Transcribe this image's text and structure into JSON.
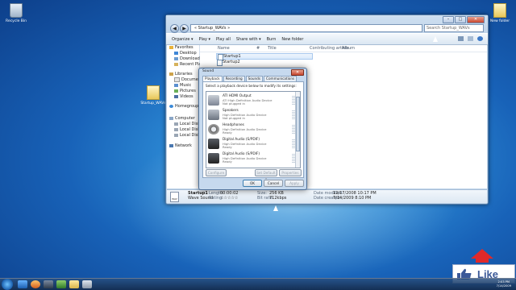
{
  "desktop": {
    "icons": {
      "recycle_bin": "Recycle Bin",
      "new_folder": "New folder",
      "startup_folder": "Startup_WAVs"
    }
  },
  "explorer": {
    "address": "« Startup_WAVs »",
    "search_placeholder": "Search Startup_WAVs",
    "toolbar": {
      "organize": "Organize ▾",
      "play": "Play ▾",
      "play_all": "Play all",
      "share_with": "Share with ▾",
      "burn": "Burn",
      "new_folder": "New folder"
    },
    "nav": {
      "favorites": "Favorites",
      "desktop": "Desktop",
      "downloads": "Downloads",
      "recent_places": "Recent Places",
      "libraries": "Libraries",
      "documents": "Documents",
      "music": "Music",
      "pictures": "Pictures",
      "videos": "Videos",
      "homegroup": "Homegroup",
      "computer": "Computer",
      "local_disk_1": "Local Disk",
      "local_disk_2": "Local Disk",
      "local_disk_3": "Local Disk",
      "network": "Network"
    },
    "columns": {
      "name": "Name",
      "num": "#",
      "title": "Title",
      "artists": "Contributing artists",
      "album": "Album"
    },
    "files": [
      "Startup1",
      "Startup2"
    ],
    "details": {
      "name": "Startup1",
      "type": "WAV",
      "length_label": "Length:",
      "length": "00:00:02",
      "rating_label": "Rating:",
      "rating_stars": "☆☆☆☆☆",
      "subtitle": "Wave Sound",
      "size_label": "Size:",
      "size": "256 KB",
      "bitrate_label": "Bit rate:",
      "bitrate": "712kbps",
      "modified_label": "Date modified:",
      "modified": "12/17/2008 10:17 PM",
      "created_label": "Date created:",
      "created": "7/14/2009 8:10 PM"
    }
  },
  "sound_dialog": {
    "title": "Sound",
    "tabs": [
      "Playback",
      "Recording",
      "Sounds",
      "Communications"
    ],
    "instruction": "Select a playback device below to modify its settings:",
    "devices": [
      {
        "name": "ATI HDMI Output",
        "line1": "ATI High Definition Audio Device",
        "line2": "Not plugged in"
      },
      {
        "name": "Speakers",
        "line1": "High Definition Audio Device",
        "line2": "Not plugged in"
      },
      {
        "name": "Headphones",
        "line1": "High Definition Audio Device",
        "line2": "Ready"
      },
      {
        "name": "Digital Audio (S/PDIF)",
        "line1": "High Definition Audio Device",
        "line2": "Ready"
      },
      {
        "name": "Digital Audio (S/PDIF)",
        "line1": "High Definition Audio Device",
        "line2": "Ready"
      }
    ],
    "buttons": {
      "configure": "Configure",
      "set_default": "Set Default ▾",
      "properties": "Properties",
      "ok": "OK",
      "cancel": "Cancel",
      "apply": "Apply"
    }
  },
  "taskbar": {
    "clock_time": "2:03 PM",
    "clock_date": "7/14/2009"
  },
  "like_badge": {
    "label": "Like"
  },
  "colors": {
    "wallpaper": "#1862b8",
    "facebook_blue": "#3b5998",
    "arrow_red": "#e0292a"
  }
}
